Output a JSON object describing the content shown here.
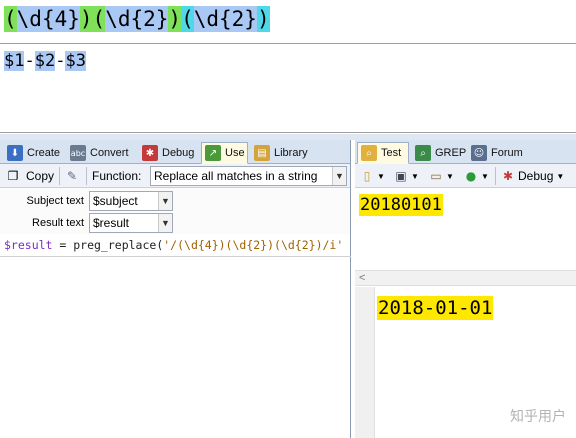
{
  "regex": {
    "tokens": [
      "(",
      "\\d{4}",
      ")",
      "(",
      "\\d{2}",
      ")",
      "(",
      "\\d{2}",
      ")"
    ]
  },
  "replacement": {
    "tokens": [
      "$1",
      "-",
      "$2",
      "-",
      "$3"
    ]
  },
  "left_tabs": [
    {
      "label": "Create",
      "icon": "create-icon"
    },
    {
      "label": "Convert",
      "icon": "convert-icon"
    },
    {
      "label": "Debug",
      "icon": "bug-icon"
    },
    {
      "label": "Use",
      "icon": "use-icon",
      "active": true
    },
    {
      "label": "Library",
      "icon": "library-icon"
    }
  ],
  "left_toolbar": {
    "copy_label": "Copy",
    "function_label": "Function:",
    "function_value": "Replace all matches in a string"
  },
  "form": {
    "subject_label": "Subject text",
    "subject_value": "$subject",
    "result_label": "Result text",
    "result_value": "$result"
  },
  "code": {
    "var": "$result",
    "eq": " = preg_replace(",
    "str": "'/(\\d{4})(\\d{2})(\\d{2})/i'"
  },
  "right_tabs": [
    {
      "label": "Test",
      "icon": "test-icon",
      "active": true
    },
    {
      "label": "GREP",
      "icon": "grep-icon"
    },
    {
      "label": "Forum",
      "icon": "forum-icon"
    }
  ],
  "right_toolbar": {
    "debug_label": "Debug"
  },
  "test": {
    "subject": "20180101",
    "result": "2018-01-01"
  },
  "watermark": "知乎用户",
  "colors": {
    "paren_green": "#7fe05a",
    "group_blue": "#a9c8f4",
    "paren_cyan": "#4fd8e8",
    "match_yellow": "#ffe800",
    "tab_bg": "#d8e3f1"
  }
}
